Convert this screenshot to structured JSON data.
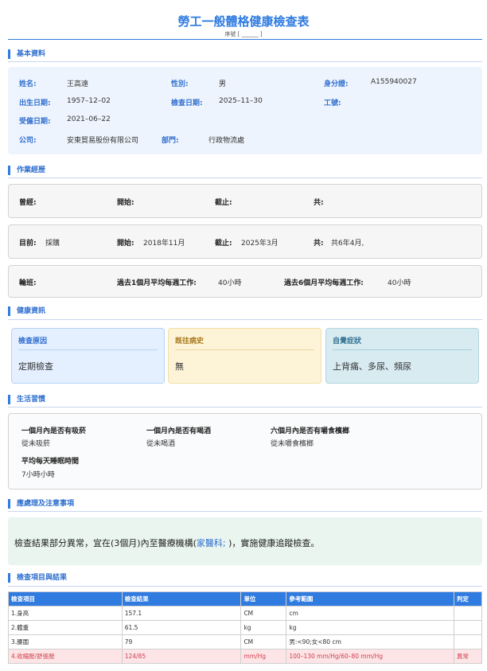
{
  "header": {
    "title": "勞工一般體格健康檢查表",
    "serial": "序號 [ ______ ]"
  },
  "sections": {
    "basic": "基本資料",
    "work": "作業經歷",
    "health": "健康資訊",
    "habits": "生活習慣",
    "advice": "應處理及注意事項",
    "results": "檢查項目與結果"
  },
  "basic": {
    "name_label": "姓名:",
    "name": "王高遠",
    "gender_label": "性別:",
    "gender": "男",
    "id_label": "身分證:",
    "id": "A155940027",
    "dob_label": "出生日期:",
    "dob": "1957–12–02",
    "exam_date_label": "檢查日期:",
    "exam_date": "2025–11–30",
    "employee_no_label": "工號:",
    "employee_no": "",
    "hire_date_label": "受僱日期:",
    "hire_date": "2021–06–22",
    "company_label": "公司:",
    "company": "安東貿易股份有限公司",
    "dept_label": "部門:",
    "dept": "行政物流處"
  },
  "work": {
    "past_label": "曾經:",
    "past": "",
    "start_label": "開始:",
    "past_start": "",
    "end_label": "截止:",
    "past_end": "",
    "total_label": "共:",
    "past_total": "",
    "current_label": "目前:",
    "current": "採購",
    "current_start": "2018年11月",
    "current_end": "2025年3月",
    "current_total": "共6年4月,",
    "shift_label": "輪班:",
    "avg1_label": "過去1個月平均每週工作:",
    "avg1": "40小時",
    "avg6_label": "過去6個月平均每週工作:",
    "avg6": "40小時"
  },
  "health": {
    "reason_label": "檢查原因",
    "reason": "定期檢查",
    "history_label": "既往病史",
    "history": "無",
    "symptoms_label": "自覺症狀",
    "symptoms": "上背痛、多尿、頻尿"
  },
  "habits": {
    "smoke_q": "一個月內是否有吸菸",
    "smoke_a": "從未吸菸",
    "drink_q": "一個月內是否有喝酒",
    "drink_a": "從未喝酒",
    "betel_q": "六個月內是否有嚼食檳榔",
    "betel_a": "從未嚼食檳榔",
    "sleep_q": "平均每天睡眠時間",
    "sleep_a": "7小時小時"
  },
  "advice": {
    "before": "檢查結果部分異常，宜在(3個月)內至醫療機構(",
    "dept": "家醫科;",
    "after": " )，實施健康追蹤檢查。"
  },
  "results": {
    "headers": [
      "檢查項目",
      "檢查結果",
      "單位",
      "參考範圍",
      "判定"
    ],
    "rows": [
      [
        "1.身高",
        "157.1",
        "CM",
        "cm",
        ""
      ],
      [
        "2.體重",
        "61.5",
        "kg",
        "kg",
        ""
      ],
      [
        "3.腰圍",
        "79",
        "CM",
        "男:<90;女<80 cm",
        ""
      ],
      [
        "4.收縮壓/舒張壓",
        "124/85",
        "mm/Hg",
        "100–130 mm/Hg/60–80 mm/Hg",
        "異常"
      ]
    ]
  },
  "colors": {
    "accent": "#2f7be0",
    "reason_bg": "#e4efff",
    "history_bg": "#fdf3d6",
    "symptoms_bg": "#d7ebf1",
    "advice_bg": "#e9f5ee",
    "abnormal_bg": "#fde4e6",
    "abnormal_text": "#d04050"
  }
}
